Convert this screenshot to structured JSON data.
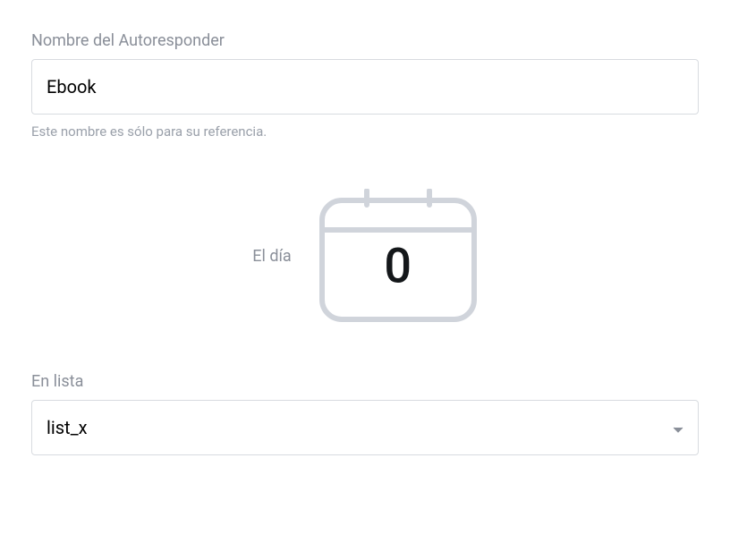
{
  "autoresponder": {
    "name_label": "Nombre del Autoresponder",
    "name_value": "Ebook",
    "name_helper": "Este nombre es sólo para su referencia."
  },
  "day": {
    "label": "El día",
    "value": "0"
  },
  "list": {
    "label": "En lista",
    "selected": "list_x"
  }
}
